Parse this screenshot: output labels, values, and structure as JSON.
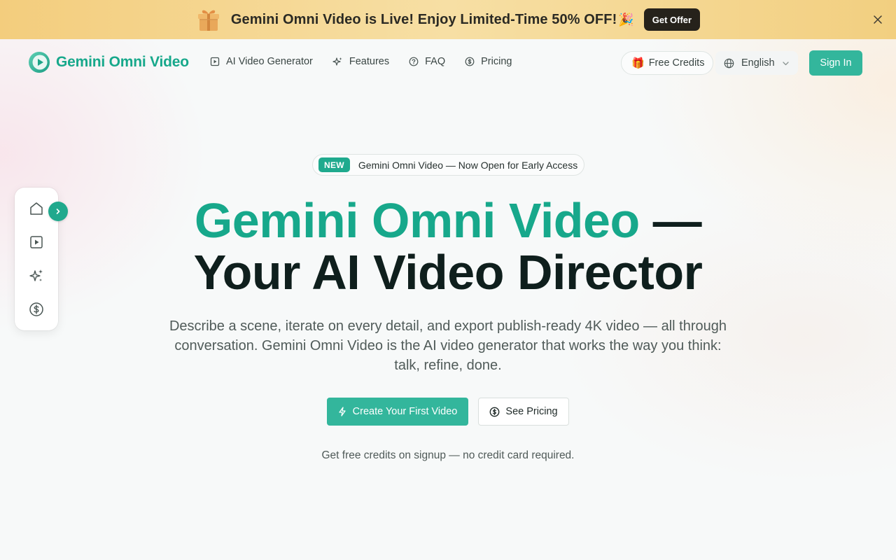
{
  "promo": {
    "text": "Gemini Omni Video is Live! Enjoy Limited-Time 50% OFF!",
    "emoji": "🎉",
    "cta_label": "Get Offer",
    "close_icon": "close-icon",
    "gift_icon": "gift-icon"
  },
  "header": {
    "logo_text": "Gemini Omni Video",
    "nav": [
      {
        "label": "AI Video Generator",
        "icon": "play-square-icon"
      },
      {
        "label": "Features",
        "icon": "sparkles-icon"
      },
      {
        "label": "FAQ",
        "icon": "help-circle-icon"
      },
      {
        "label": "Pricing",
        "icon": "dollar-circle-icon"
      }
    ],
    "free_credits_label": "Free Credits",
    "free_credits_emoji": "🎁",
    "language": "English",
    "sign_in_label": "Sign In"
  },
  "rail": {
    "items": [
      "home-icon",
      "play-square-icon",
      "sparkles-icon",
      "dollar-circle-icon"
    ],
    "toggle_icon": "chevron-right-icon"
  },
  "hero": {
    "badge_tag": "NEW",
    "badge_text": "Gemini Omni Video — Now Open for Early Access",
    "title_accent": "Gemini Omni Video",
    "title_dash": " —",
    "title_line2": "Your AI Video Director",
    "subtitle": "Describe a scene, iterate on every detail, and export publish-ready 4K video — all through conversation. Gemini Omni Video is the AI video generator that works the way you think: talk, refine, done.",
    "primary_cta": "Create Your First Video",
    "secondary_cta": "See Pricing",
    "note": "Get free credits on signup — no credit card required."
  },
  "colors": {
    "brand": "#17a88b",
    "button": "#33b69c",
    "banner": "#f3cd7d",
    "dark_text": "#0f1f1d"
  }
}
